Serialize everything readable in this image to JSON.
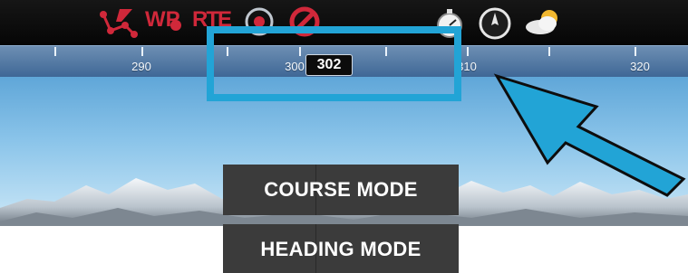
{
  "toolbar": {
    "icons": [
      {
        "name": "track-edit-icon"
      },
      {
        "name": "waypoint-icon",
        "label": "WP"
      },
      {
        "name": "route-icon",
        "label": "RTE"
      },
      {
        "name": "poi-icon"
      },
      {
        "name": "no-entry-icon"
      },
      {
        "name": "stopwatch-icon"
      },
      {
        "name": "compass-icon"
      },
      {
        "name": "weather-icon"
      }
    ]
  },
  "heading_ruler": {
    "tick_labels": [
      "290",
      "300",
      "310",
      "320"
    ],
    "current_heading": "302"
  },
  "buttons": {
    "course_mode": "COURSE MODE",
    "heading_mode": "HEADING MODE"
  },
  "colors": {
    "highlight": "#22a4d6",
    "toolbar_icon_red": "#d0283a",
    "button_bg": "#3b3b3b"
  }
}
